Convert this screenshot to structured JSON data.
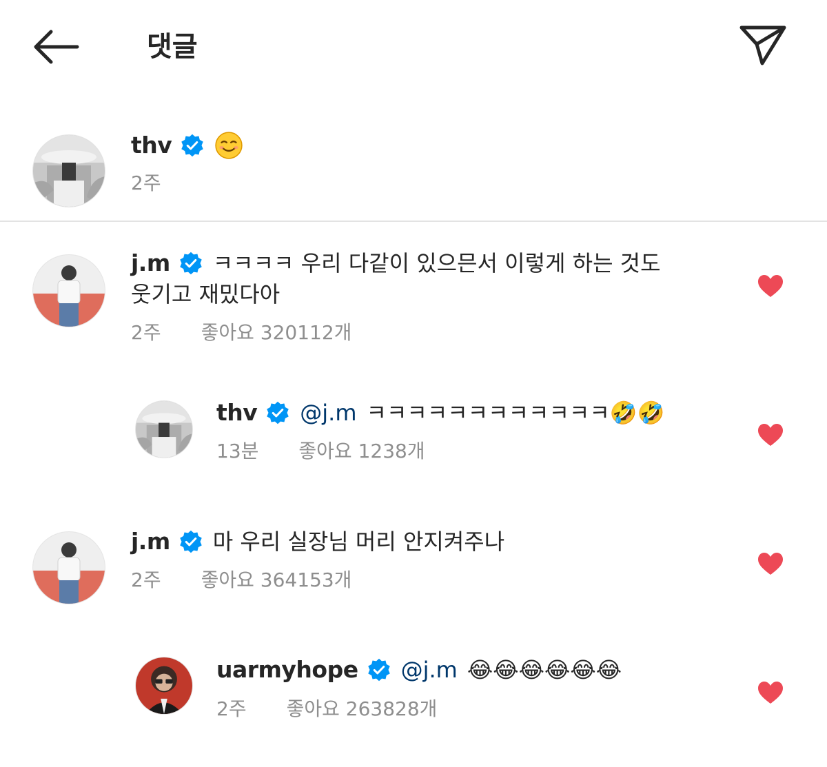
{
  "header": {
    "title": "댓글",
    "back_icon": "arrow-left-icon",
    "share_icon": "paper-plane-icon"
  },
  "caption": {
    "username": "thv",
    "emoji": "☺️",
    "time": "2주"
  },
  "comments": [
    {
      "username": "j.m",
      "text_line1": "ㅋㅋㅋㅋ 우리 다같이 있으믄서 이렇게 하는 것도",
      "text_line2": "웃기고 재밌다아",
      "time": "2주",
      "likes": "좋아요 320112개"
    },
    {
      "username": "thv",
      "mention": "@j.m",
      "text": "ㅋㅋㅋㅋㅋㅋㅋㅋㅋㅋㅋㅋ🤣🤣",
      "time": "13분",
      "likes": "좋아요 1238개"
    },
    {
      "username": "j.m",
      "text": "마 우리 실장님 머리 안지켜주나",
      "time": "2주",
      "likes": "좋아요 364153개"
    },
    {
      "username": "uarmyhope",
      "mention": "@j.m",
      "text": "😂😂😂😂😂😂",
      "time": "2주",
      "likes": "좋아요 263828개"
    }
  ],
  "colors": {
    "verified_badge": "#0095f6",
    "heart": "#ed4956",
    "meta_text": "#8e8e8e",
    "mention": "#00376b",
    "divider": "#e3e3e3"
  }
}
